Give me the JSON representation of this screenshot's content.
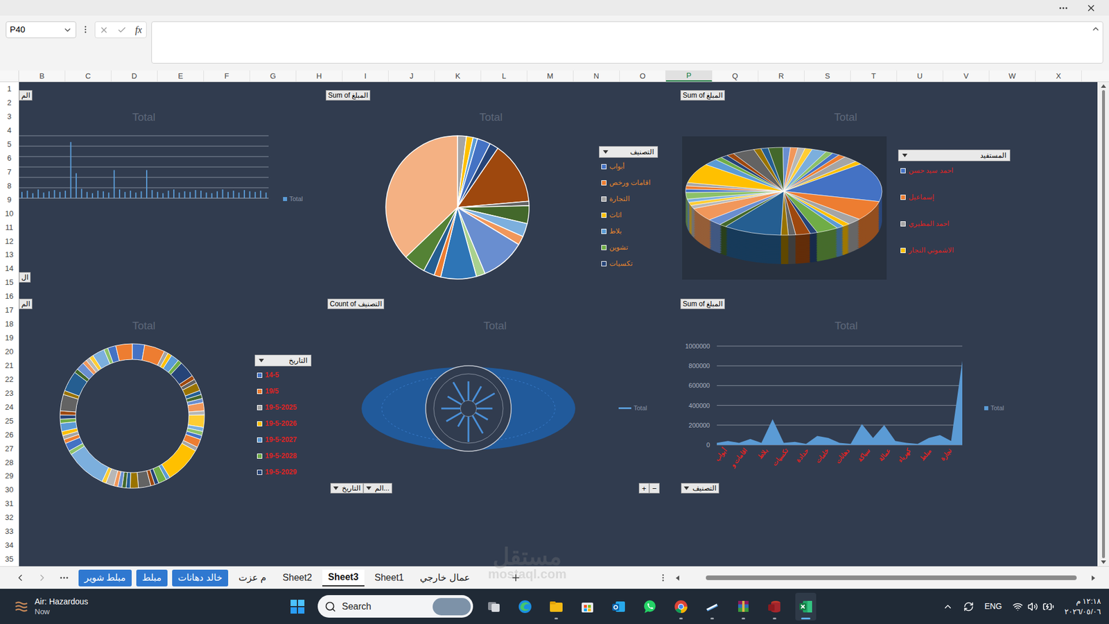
{
  "formula_bar": {
    "name_box": "P40",
    "fx": "fx"
  },
  "columns": [
    {
      "label": "B",
      "selected": false
    },
    {
      "label": "C",
      "selected": false
    },
    {
      "label": "D",
      "selected": false
    },
    {
      "label": "E",
      "selected": false
    },
    {
      "label": "F",
      "selected": false
    },
    {
      "label": "G",
      "selected": false
    },
    {
      "label": "H",
      "selected": false
    },
    {
      "label": "I",
      "selected": false
    },
    {
      "label": "J",
      "selected": false
    },
    {
      "label": "K",
      "selected": false
    },
    {
      "label": "L",
      "selected": false
    },
    {
      "label": "M",
      "selected": false
    },
    {
      "label": "N",
      "selected": false
    },
    {
      "label": "O",
      "selected": false
    },
    {
      "label": "P",
      "selected": true
    },
    {
      "label": "Q",
      "selected": false
    },
    {
      "label": "R",
      "selected": false
    },
    {
      "label": "S",
      "selected": false
    },
    {
      "label": "T",
      "selected": false
    },
    {
      "label": "U",
      "selected": false
    },
    {
      "label": "V",
      "selected": false
    },
    {
      "label": "W",
      "selected": false
    },
    {
      "label": "X",
      "selected": false
    }
  ],
  "rows": [
    "1",
    "2",
    "3",
    "4",
    "5",
    "6",
    "7",
    "8",
    "9",
    "10",
    "11",
    "12",
    "13",
    "14",
    "15",
    "16",
    "17",
    "18",
    "19",
    "20",
    "21",
    "22",
    "23",
    "24",
    "25",
    "26",
    "27",
    "28",
    "29",
    "30",
    "31",
    "32",
    "33",
    "34",
    "35"
  ],
  "bar_chart": {
    "field_button": "الم",
    "bottom_button": "ال",
    "title": "Total",
    "legend": "Total",
    "values": [
      10,
      12,
      8,
      14,
      9,
      11,
      13,
      10,
      12,
      90,
      40,
      15,
      10,
      8,
      12,
      11,
      9,
      45,
      14,
      10,
      12,
      9,
      11,
      45,
      13,
      10,
      8,
      12,
      14,
      9,
      11,
      10,
      13,
      12,
      9,
      8,
      11,
      14,
      10,
      12,
      9,
      13,
      11,
      10,
      12,
      9
    ]
  },
  "pie_chart": {
    "field_button": "Sum of المبلغ",
    "title": "Total",
    "legend_header": "التصنيف",
    "slices": [
      {
        "value": 2,
        "color": "#a5a5a5"
      },
      {
        "value": 1.5,
        "color": "#ffc000"
      },
      {
        "value": 1,
        "color": "#5b9bd5"
      },
      {
        "value": 3,
        "color": "#4472c4"
      },
      {
        "value": 2,
        "color": "#264478"
      },
      {
        "value": 14,
        "color": "#9e480e"
      },
      {
        "value": 1,
        "color": "#636363"
      },
      {
        "value": 4,
        "color": "#43682b"
      },
      {
        "value": 3,
        "color": "#7cafdd"
      },
      {
        "value": 2,
        "color": "#f1975a"
      },
      {
        "value": 10,
        "color": "#698ed0"
      },
      {
        "value": 2,
        "color": "#a9d18e"
      },
      {
        "value": 8,
        "color": "#2e75b6"
      },
      {
        "value": 1.5,
        "color": "#ed7d31"
      },
      {
        "value": 2.5,
        "color": "#255e91"
      },
      {
        "value": 5,
        "color": "#548235"
      },
      {
        "value": 37,
        "color": "#f4b183"
      }
    ],
    "legend": [
      {
        "label": "أبواب",
        "color": "#4472c4"
      },
      {
        "label": "اقامات ورخص",
        "color": "#ed7d31"
      },
      {
        "label": "التجارة",
        "color": "#a5a5a5"
      },
      {
        "label": "اثاث",
        "color": "#ffc000"
      },
      {
        "label": "بلاط",
        "color": "#5b9bd5"
      },
      {
        "label": "تشوين",
        "color": "#70ad47"
      },
      {
        "label": "تكسيات",
        "color": "#264478"
      }
    ]
  },
  "pie3d_chart": {
    "field_button": "Sum of المبلغ",
    "title": "Total",
    "legend_header": "المستفيد",
    "values": [
      12,
      6,
      2,
      1,
      1,
      3,
      1,
      2,
      1,
      1,
      8,
      1,
      2,
      4,
      1,
      1,
      1,
      2,
      1,
      1,
      1,
      6,
      2,
      1,
      1,
      1,
      3,
      1,
      1,
      2,
      1,
      1,
      1,
      1,
      2,
      1,
      1,
      1,
      2,
      1
    ],
    "legend": [
      {
        "label": "احمد سيد حسن",
        "color": "#4472c4"
      },
      {
        "label": "إسماعيل",
        "color": "#ed7d31"
      },
      {
        "label": "احمد المطيري",
        "color": "#a5a5a5"
      },
      {
        "label": "الاشموني النجار",
        "color": "#ffc000"
      }
    ]
  },
  "donut_chart": {
    "field_button": "الم",
    "title": "Total",
    "legend_header": "التاريخ",
    "values": [
      3,
      5,
      1,
      1,
      2,
      1,
      4,
      1,
      1,
      2,
      1,
      1,
      1,
      2,
      1,
      3,
      1,
      1,
      1,
      2,
      1,
      9,
      1,
      2,
      1,
      1,
      3,
      2,
      1,
      1,
      1,
      1,
      2,
      1,
      10,
      1,
      2,
      1,
      1,
      1,
      2,
      1,
      1,
      1,
      4,
      1,
      5,
      1,
      2,
      1,
      1,
      1,
      3,
      1,
      2,
      4
    ],
    "legend": [
      {
        "label": "14-5",
        "color": "#4472c4"
      },
      {
        "label": "19/5",
        "color": "#ed7d31"
      },
      {
        "label": "19-5-2025",
        "color": "#a5a5a5"
      },
      {
        "label": "19-5-2026",
        "color": "#ffc000"
      },
      {
        "label": "19-5-2027",
        "color": "#5b9bd5"
      },
      {
        "label": "19-5-2028",
        "color": "#70ad47"
      },
      {
        "label": "19-5-2029",
        "color": "#264478"
      }
    ]
  },
  "radar_chart": {
    "field_button": "Count of التصنيف",
    "title": "Total",
    "legend": "Total",
    "values": [
      60,
      55,
      70,
      50,
      45,
      65,
      80,
      40,
      55,
      60,
      50,
      70
    ],
    "filter_buttons": [
      "التاريخ",
      "الم..."
    ],
    "expand": "+",
    "collapse": "−"
  },
  "area_chart": {
    "field_button": "Sum of المبلغ",
    "title": "Total",
    "legend": "Total",
    "filter_button": "التصنيف",
    "y_ticks": [
      "1000000",
      "800000",
      "600000",
      "400000",
      "200000",
      "0"
    ],
    "values": [
      20000,
      40000,
      20000,
      60000,
      20000,
      260000,
      20000,
      30000,
      10000,
      90000,
      70000,
      20000,
      10000,
      210000,
      70000,
      200000,
      40000,
      20000,
      10000,
      70000,
      100000,
      40000,
      850000
    ],
    "categories": [
      "أبواب",
      "اقامات و",
      "بلاط",
      "تكسيات",
      "حدادة",
      "خامات",
      "دهانات",
      "سباكة",
      "عمالة",
      "كهرباء",
      "مبلط",
      "نجارة"
    ]
  },
  "sheet_tabs": [
    {
      "label": "مبلط شوير",
      "kind": "colored",
      "color": "#2f78d0",
      "selected": false
    },
    {
      "label": "مبلط",
      "kind": "colored",
      "color": "#2f78d0",
      "selected": false
    },
    {
      "label": "خالد دهانات",
      "kind": "colored",
      "color": "#2f78d0",
      "selected": false
    },
    {
      "label": "م عزت",
      "kind": "plain",
      "selected": false
    },
    {
      "label": "Sheet2",
      "kind": "plain",
      "selected": false
    },
    {
      "label": "Sheet3",
      "kind": "plain",
      "selected": true
    },
    {
      "label": "Sheet1",
      "kind": "plain",
      "selected": false
    },
    {
      "label": "عمال خارجي",
      "kind": "plain",
      "selected": false
    }
  ],
  "taskbar": {
    "weather": {
      "title": "Air: Hazardous",
      "subtitle": "Now"
    },
    "search": {
      "placeholder": "Search"
    },
    "apps": [
      {
        "kind": "taskview",
        "running": false,
        "active": false
      },
      {
        "kind": "edge",
        "running": false,
        "active": false
      },
      {
        "kind": "explorer",
        "running": true,
        "active": false
      },
      {
        "kind": "store",
        "running": false,
        "active": false
      },
      {
        "kind": "outlook",
        "running": false,
        "active": false
      },
      {
        "kind": "whatsapp",
        "running": false,
        "active": false
      },
      {
        "kind": "chrome",
        "running": true,
        "active": false
      },
      {
        "kind": "app",
        "running": true,
        "active": false
      },
      {
        "kind": "winrar",
        "running": true,
        "active": false
      },
      {
        "kind": "access",
        "running": true,
        "active": false
      },
      {
        "kind": "excel",
        "running": true,
        "active": true
      }
    ],
    "tray": {
      "language": "ENG",
      "time": "١٢:١٨ م",
      "date": "٢٠٢٦/٠٥/٠٦"
    }
  },
  "watermark": {
    "arabic": "مستقل",
    "latin": "mostaql.com"
  }
}
